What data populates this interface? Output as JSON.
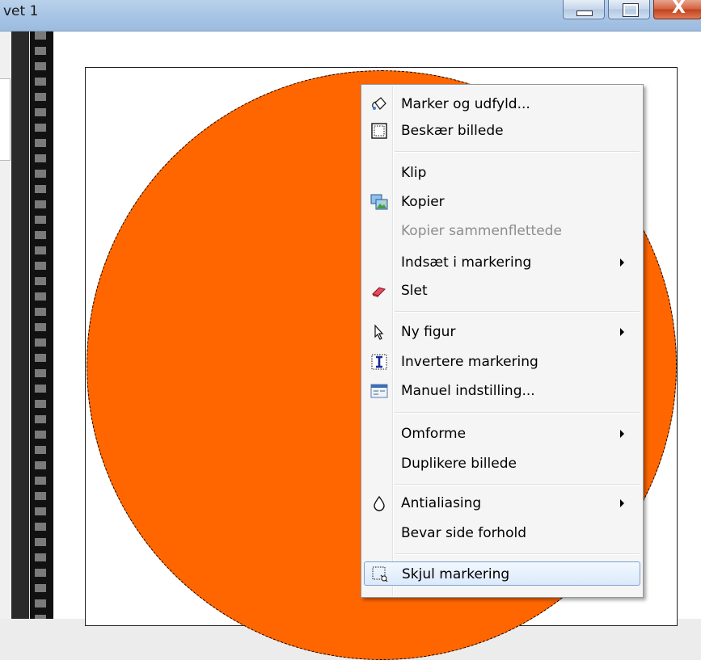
{
  "window": {
    "title": "vet 1",
    "minimize_icon": "minimize-icon",
    "maximize_icon": "maximize-icon",
    "close_icon": "close-icon",
    "close_glyph": "X"
  },
  "canvas": {
    "shape_color": "#ff6600",
    "selection_style": "dashed marquee"
  },
  "context_menu": {
    "items": [
      {
        "label": "Marker og udfyld...",
        "icon": "paint-bucket-icon",
        "enabled": true,
        "submenu": false
      },
      {
        "label": "Beskær billede",
        "icon": "crop-icon",
        "enabled": true,
        "submenu": false
      },
      {
        "label": "Klip",
        "icon": null,
        "enabled": true,
        "submenu": false
      },
      {
        "label": "Kopier",
        "icon": "copy-image-icon",
        "enabled": true,
        "submenu": false
      },
      {
        "label": "Kopier sammenflettede",
        "icon": null,
        "enabled": false,
        "submenu": false
      },
      {
        "label": "Indsæt i markering",
        "icon": null,
        "enabled": true,
        "submenu": true
      },
      {
        "label": "Slet",
        "icon": "eraser-icon",
        "enabled": true,
        "submenu": false
      },
      {
        "label": "Ny figur",
        "icon": "pointer-icon",
        "enabled": true,
        "submenu": true
      },
      {
        "label": "Invertere markering",
        "icon": "invert-selection-icon",
        "enabled": true,
        "submenu": false
      },
      {
        "label": "Manuel indstilling...",
        "icon": "manual-settings-icon",
        "enabled": true,
        "submenu": false
      },
      {
        "label": "Omforme",
        "icon": null,
        "enabled": true,
        "submenu": true
      },
      {
        "label": "Duplikere billede",
        "icon": null,
        "enabled": true,
        "submenu": false
      },
      {
        "label": "Antialiasing",
        "icon": "drop-icon",
        "enabled": true,
        "submenu": true
      },
      {
        "label": "Bevar side forhold",
        "icon": null,
        "enabled": true,
        "submenu": false
      },
      {
        "label": "Skjul markering",
        "icon": "hide-selection-icon",
        "enabled": true,
        "submenu": false,
        "highlighted": true
      }
    ]
  }
}
